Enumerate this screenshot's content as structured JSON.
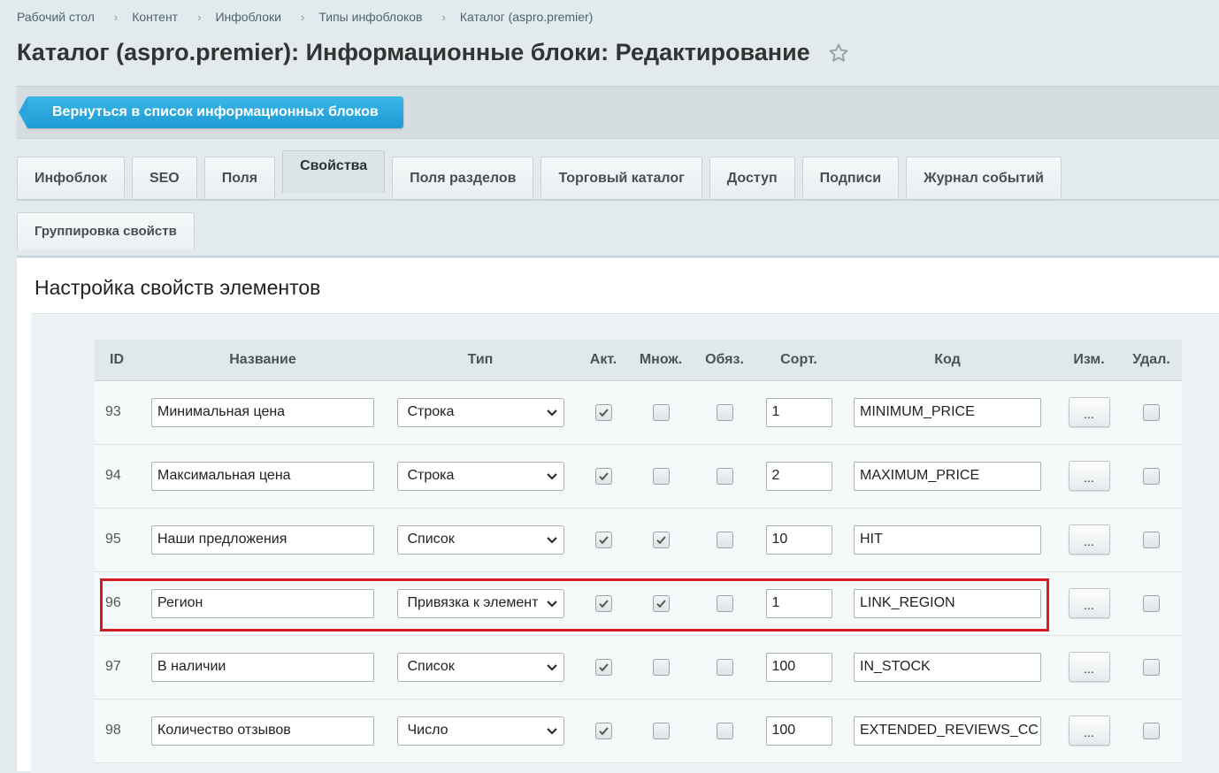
{
  "breadcrumb": [
    "Рабочий стол",
    "Контент",
    "Инфоблоки",
    "Типы инфоблоков",
    "Каталог (aspro.premier)"
  ],
  "page_title": "Каталог (aspro.premier): Информационные блоки: Редактирование",
  "back_button_label": "Вернуться в список информационных блоков",
  "tabs": [
    "Инфоблок",
    "SEO",
    "Поля",
    "Свойства",
    "Поля разделов",
    "Торговый каталог",
    "Доступ",
    "Подписи",
    "Журнал событий"
  ],
  "active_tab": "Свойства",
  "subtabs": [
    "Группировка свойств"
  ],
  "section_title": "Настройка свойств элементов",
  "table": {
    "headers": [
      "ID",
      "Название",
      "Тип",
      "Акт.",
      "Множ.",
      "Обяз.",
      "Сорт.",
      "Код",
      "Изм.",
      "Удал."
    ],
    "edit_label": "...",
    "rows": [
      {
        "id": "93",
        "name": "Минимальная цена",
        "type": "Строка",
        "active": true,
        "multiple": false,
        "required": false,
        "sort": "1",
        "code": "MINIMUM_PRICE",
        "delete": false
      },
      {
        "id": "94",
        "name": "Максимальная цена",
        "type": "Строка",
        "active": true,
        "multiple": false,
        "required": false,
        "sort": "2",
        "code": "MAXIMUM_PRICE",
        "delete": false
      },
      {
        "id": "95",
        "name": "Наши предложения",
        "type": "Список",
        "active": true,
        "multiple": true,
        "required": false,
        "sort": "10",
        "code": "HIT",
        "delete": false
      },
      {
        "id": "96",
        "name": "Регион",
        "type": "Привязка к элемент",
        "active": true,
        "multiple": true,
        "required": false,
        "sort": "1",
        "code": "LINK_REGION",
        "delete": false,
        "highlighted": true
      },
      {
        "id": "97",
        "name": "В наличии",
        "type": "Список",
        "active": true,
        "multiple": false,
        "required": false,
        "sort": "100",
        "code": "IN_STOCK",
        "delete": false
      },
      {
        "id": "98",
        "name": "Количество отзывов",
        "type": "Число",
        "active": true,
        "multiple": false,
        "required": false,
        "sort": "100",
        "code": "EXTENDED_REVIEWS_CC",
        "delete": false
      }
    ]
  },
  "colors": {
    "accent_button": "#1d9ad2",
    "highlight": "#d71920"
  }
}
